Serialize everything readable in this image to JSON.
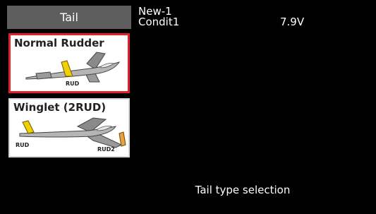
{
  "screen": {
    "tab_title": "Tail",
    "model_name": "New-1",
    "condition": "Condit1",
    "voltage": "7.9V",
    "footer_prompt": "Tail type selection"
  },
  "options": [
    {
      "label": "Normal Rudder",
      "tags": [
        "RUD"
      ],
      "selected": true
    },
    {
      "label": "Winglet (2RUD)",
      "tags": [
        "RUD",
        "RUD2"
      ],
      "selected": false
    }
  ],
  "colors": {
    "background": "#000000",
    "header": "#5e5e5e",
    "selection_border": "#e0202a",
    "rudder_highlight": "#f0d000"
  }
}
